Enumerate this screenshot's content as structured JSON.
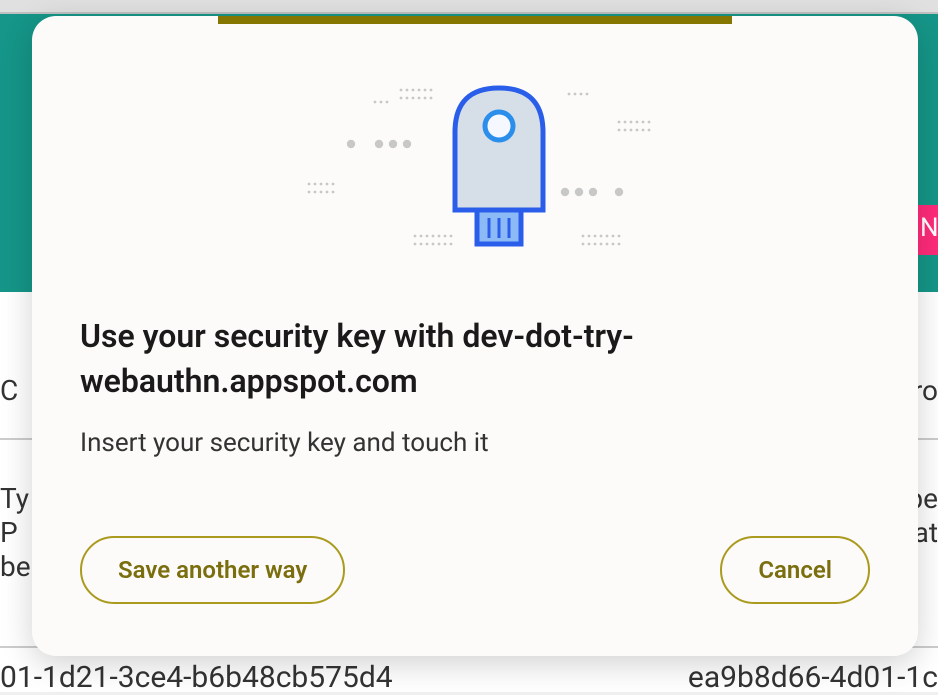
{
  "background": {
    "left_c": "C",
    "right_ro": "ro",
    "pink_n": "N",
    "left_ty": "Ty",
    "right_pe": "pe",
    "left_p": " P",
    "right_at": "at",
    "left_be": "be",
    "bottom_left": "01-1d21-3ce4-b6b48cb575d4",
    "bottom_right": "ea9b8d66-4d01-1c"
  },
  "modal": {
    "title": "Use your security key with dev-dot-try-webauthn.appspot.com",
    "subtitle": "Insert your security key and touch it",
    "save_another_way_label": "Save another way",
    "cancel_label": "Cancel"
  }
}
